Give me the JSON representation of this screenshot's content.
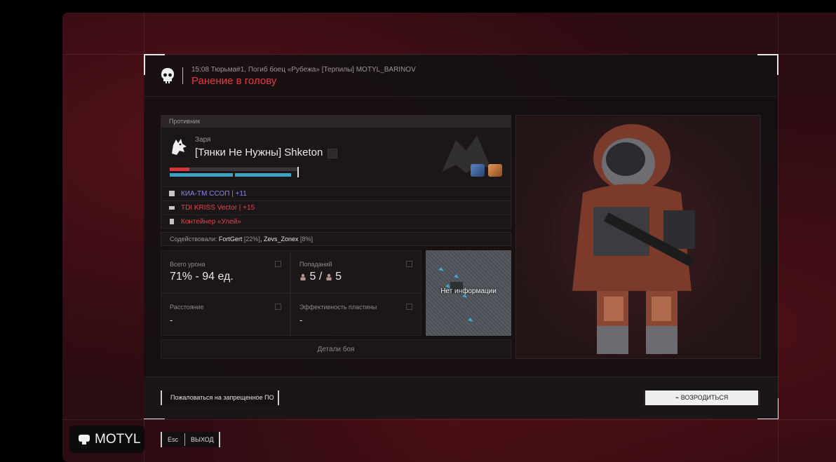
{
  "header": {
    "meta": "15:08 Тюрьма#1, Погиб боец «Рубежа» [Терпилы] MOTYL_BARINOV",
    "title": "Ранение в голову"
  },
  "enemy": {
    "section_label": "Противник",
    "clan": "Заря",
    "name": "[Тянки Не Нужны] Shketon",
    "equipment": [
      {
        "icon": "armor-icon",
        "text": "КИА-ТМ ССОП | +11",
        "color": "#8d7ff0"
      },
      {
        "icon": "gun-icon",
        "text": "TDI KRISS Vector | +15",
        "color": "#e5414b"
      },
      {
        "icon": "container-icon",
        "text": "Контейнер «Улей»",
        "color": "#e5414b"
      }
    ]
  },
  "assist": {
    "label": "Содействовали:",
    "p1": "FortGert",
    "p1_pct": "[22%]",
    "sep": ",",
    "p2": "Zevs_Zonex",
    "p2_pct": "[8%]"
  },
  "stats": {
    "damage_label": "Всего урона",
    "damage_value": "71% - 94 ед.",
    "hits_label": "Попаданий",
    "hits_a": "5",
    "hits_sep": "/",
    "hits_b": "5",
    "distance_label": "Расстояние",
    "distance_value": "-",
    "plate_label": "Эффективность пластины",
    "plate_value": "-"
  },
  "map": {
    "label": "Нет информации"
  },
  "details_label": "Детали боя",
  "footer": {
    "report_label": "Пожаловаться на запрещенное ПО",
    "respawn_label": "ВОЗРОДИТЬСЯ"
  },
  "player": {
    "name": "MOTYL"
  },
  "esc": {
    "key": "Esc",
    "label": "ВЫХОД"
  },
  "colors": {
    "accent_red": "#e53a45",
    "armor_bar": "#39a4c4"
  }
}
